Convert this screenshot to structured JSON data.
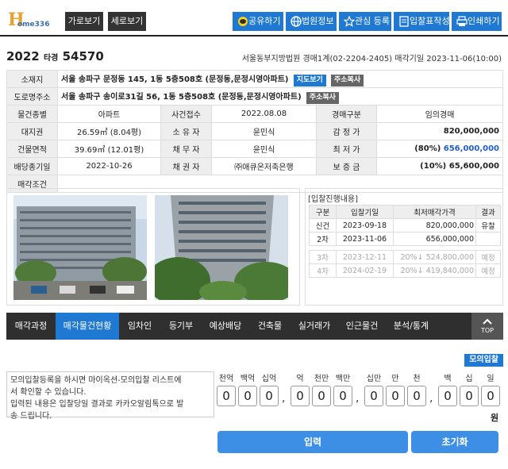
{
  "logo": {
    "mark": "H",
    "text": "ome336"
  },
  "view_buttons": [
    "가로보기",
    "세로보기"
  ],
  "actions": [
    {
      "label": "공유하기",
      "icon": "chat-icon"
    },
    {
      "label": "법원정보",
      "icon": "globe-icon"
    },
    {
      "label": "관심 등록",
      "icon": "star-icon"
    },
    {
      "label": "입찰표작성",
      "icon": "form-icon"
    },
    {
      "label": "인쇄하기",
      "icon": "print-icon"
    }
  ],
  "case": {
    "year": "2022",
    "type": "타경",
    "number": "54570",
    "court": "서울동부지방법원 경매1계(02-2204-2405)",
    "sale_date": "매각기일 2023-11-06(10:00)"
  },
  "info": {
    "address_label": "소재지",
    "address": "서울 송파구 문정동 145, 1동 5층508호 (문정동,문정시영아파트)",
    "road_label": "도로명주소",
    "road": "서울 송파구 송이로31길 56, 1동 5층508호 (문정동,문정시영아파트)",
    "map_btn": "지도보기",
    "copy_btn": "주소복사",
    "rows": [
      [
        {
          "l": "물건종별",
          "v": "아파트"
        },
        {
          "l": "사건접수",
          "v": "2022.08.08"
        },
        {
          "l": "경매구분",
          "v": "임의경매"
        }
      ],
      [
        {
          "l": "대지권",
          "v": "26.59㎡ (8.04평)"
        },
        {
          "l": "소 유 자",
          "v": "윤민식"
        },
        {
          "l": "감 정 가",
          "v": "820,000,000"
        }
      ],
      [
        {
          "l": "건물면적",
          "v": "39.69㎡ (12.01평)"
        },
        {
          "l": "채 무 자",
          "v": "윤민식"
        },
        {
          "l": "최 저 가",
          "v_pct": "(80%)",
          "v": "656,000,000"
        }
      ],
      [
        {
          "l": "배당종기일",
          "v": "2022-10-26"
        },
        {
          "l": "채 권 자",
          "v": "㈜애큐온저축은행"
        },
        {
          "l": "보 증 금",
          "v": "(10%) 65,600,000"
        }
      ]
    ],
    "sale_cond_label": "매각조건",
    "sale_cond": ""
  },
  "history": {
    "title": "[입찰진행내용]",
    "headers": [
      "구분",
      "입찰기일",
      "최저매각가격",
      "결과"
    ],
    "rows": [
      {
        "c": "신건",
        "d": "2023-09-18",
        "p": "820,000,000",
        "r": "유찰"
      },
      {
        "c": "2차",
        "d": "2023-11-06",
        "p": "656,000,000",
        "r": ""
      }
    ],
    "future": [
      {
        "c": "3차",
        "d": "2023-12-11",
        "pct": "20%↓",
        "p": "524,800,000",
        "r": "예정"
      },
      {
        "c": "4차",
        "d": "2024-02-19",
        "pct": "20%↓",
        "p": "419,840,000",
        "r": "예정"
      }
    ]
  },
  "tabs": [
    "매각과정",
    "매각물건현황",
    "임차인",
    "등기부",
    "예상배당",
    "건축물",
    "실거래가",
    "인근물건",
    "분석/통계"
  ],
  "top_label": "TOP",
  "mock": {
    "tag": "모의입찰",
    "desc": [
      "모의입찰등록을 하시면 마이옥션-모의입찰 리스트에",
      "서 확인할 수 있습니다.",
      "입력된 내용은 입찰당일 결과로 카카오알림톡으로 발",
      "송 드립니다."
    ],
    "units": [
      "천억",
      "백억",
      "십억",
      "억",
      "천만",
      "백만",
      "십만",
      "만",
      "천",
      "백",
      "십",
      "일"
    ],
    "digits": [
      "0",
      "0",
      "0",
      "0",
      "0",
      "0",
      "0",
      "0",
      "0",
      "0",
      "0",
      "0"
    ],
    "won": "원",
    "submit": "입력",
    "reset": "초기화"
  }
}
